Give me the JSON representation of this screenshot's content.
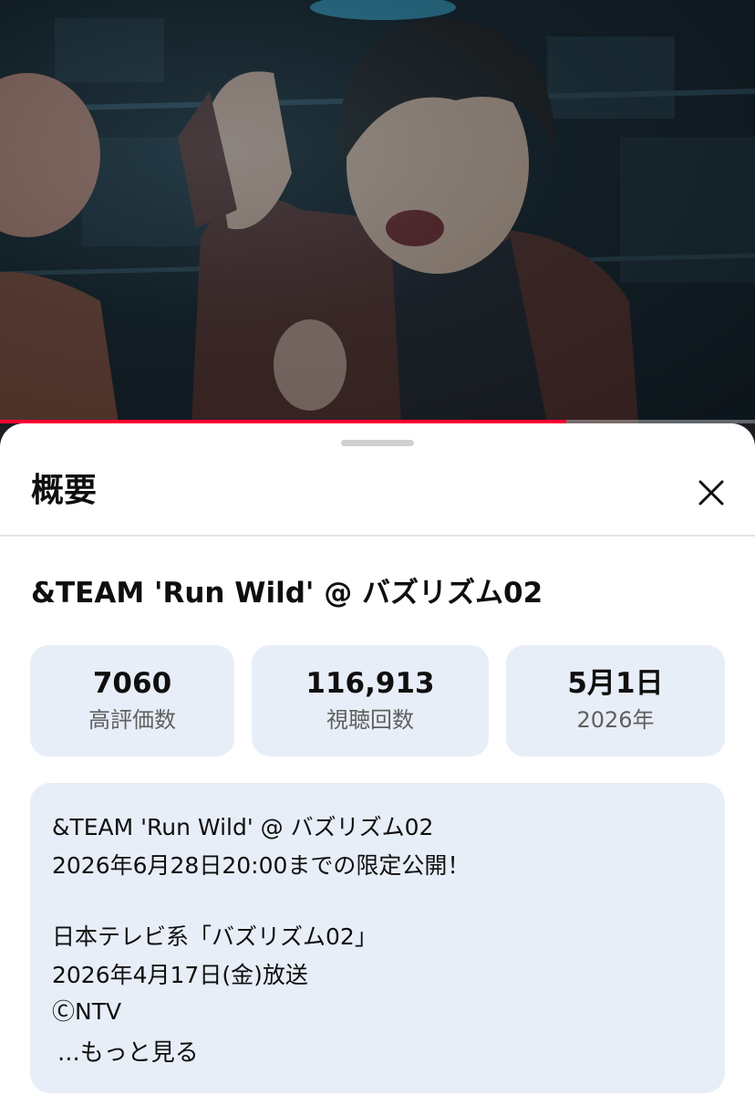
{
  "video": {
    "image_label": "video-frame-performer",
    "progress_fraction": 0.75
  },
  "sheet": {
    "title": "概要",
    "close_icon": "close-icon"
  },
  "video_info": {
    "title": "&TEAM 'Run Wild' @ バズリズム02",
    "stats": [
      {
        "value": "7060",
        "label": "高評価数"
      },
      {
        "value": "116,913",
        "label": "視聴回数"
      },
      {
        "value": "5月1日",
        "label": "2026年"
      }
    ]
  },
  "description": {
    "lines": [
      "&TEAM 'Run Wild' @ バズリズム02",
      "2026年6月28日20:00までの限定公開！",
      "",
      "日本テレビ系「バズリズム02」",
      "2026年4月17日(金)放送",
      "ⒸNTV"
    ],
    "more_label": "...もっと見る"
  },
  "colors": {
    "progress": "#ff0033",
    "card_bg": "#e8eef7",
    "text_primary": "#0f0f0f",
    "text_secondary": "#606060"
  }
}
